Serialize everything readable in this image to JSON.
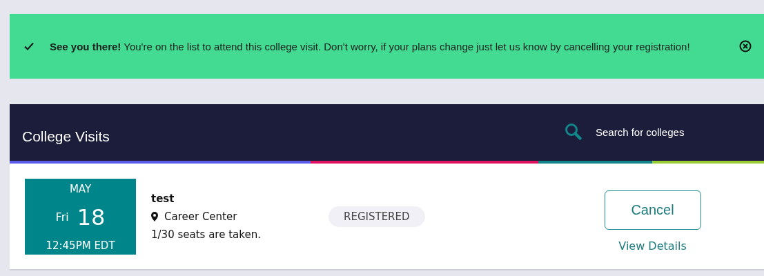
{
  "alert": {
    "message": "**See you there!**  You're on the list to attend this college visit. Don't worry, if your plans change just let us know by cancelling your registration!"
  },
  "header": {
    "title": "College Visits",
    "search": {
      "placeholder": "Search for colleges"
    }
  },
  "visits": [
    {
      "month": "MAY",
      "weekday": "Fri",
      "day": "18",
      "time": "12:45PM EDT",
      "title": "test",
      "location": "Career Center",
      "seats": "1/30 seats are taken.",
      "status": "REGISTERED",
      "cancel": "Cancel",
      "details": "View Details"
    }
  ]
}
